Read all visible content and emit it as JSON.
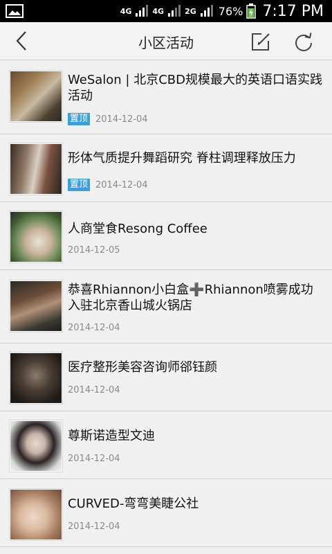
{
  "status_bar": {
    "net1": "4G",
    "net2": "4G",
    "net3": "2G",
    "battery_pct": "76%",
    "time": "7:17 PM"
  },
  "header": {
    "title": "小区活动",
    "icons": {
      "back": "chevron-left-icon",
      "compose": "edit-icon",
      "refresh": "refresh-icon"
    }
  },
  "colors": {
    "pin_badge": "#3a9ee0",
    "date_text": "#8a8a8a",
    "divider": "#d0d0d0",
    "background": "#f0f0f0"
  },
  "activities": [
    {
      "title": "WeSalon | 北京CBD规模最大的英语口语实践活动",
      "pinned_label": "置顶",
      "date": "2014-12-04"
    },
    {
      "title": "形体气质提升舞蹈研究 脊柱调理释放压力",
      "pinned_label": "置顶",
      "date": "2014-12-04"
    },
    {
      "title": "人商堂食Resong Coffee",
      "pinned_label": "",
      "date": "2014-12-05"
    },
    {
      "title": "恭喜Rhiannon小白盒➕Rhiannon喷雾成功入驻北京香山城火锅店",
      "pinned_label": "",
      "date": "2014-12-04"
    },
    {
      "title": "医疗整形美容咨询师郤钰颜",
      "pinned_label": "",
      "date": "2014-12-04"
    },
    {
      "title": "尊斯诺造型文迪",
      "pinned_label": "",
      "date": "2014-12-04"
    },
    {
      "title": "CURVED-弯弯美睫公社",
      "pinned_label": "",
      "date": "2014-12-04"
    }
  ]
}
